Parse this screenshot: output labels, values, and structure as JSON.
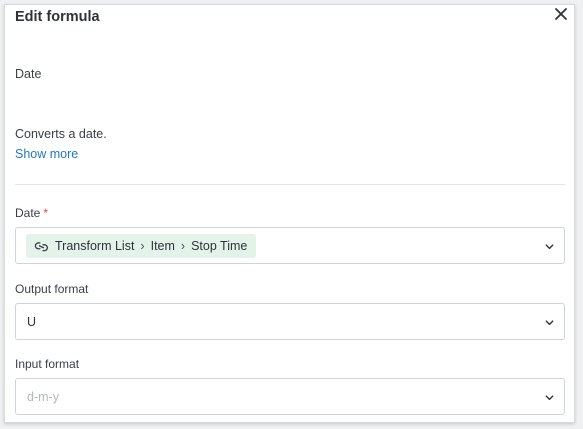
{
  "dialog": {
    "title": "Edit formula",
    "function_name": "Date",
    "description": "Converts a date.",
    "show_more": "Show more"
  },
  "fields": {
    "date": {
      "label": "Date",
      "required_mark": "*",
      "chip": [
        "Transform List",
        "Item",
        "Stop Time"
      ]
    },
    "output_format": {
      "label": "Output format",
      "value": "U"
    },
    "input_format": {
      "label": "Input format",
      "placeholder": "d-m-y"
    }
  },
  "colors": {
    "link": "#1f78c8",
    "chip_bg": "#e3f3ea",
    "required": "#e0463a"
  }
}
